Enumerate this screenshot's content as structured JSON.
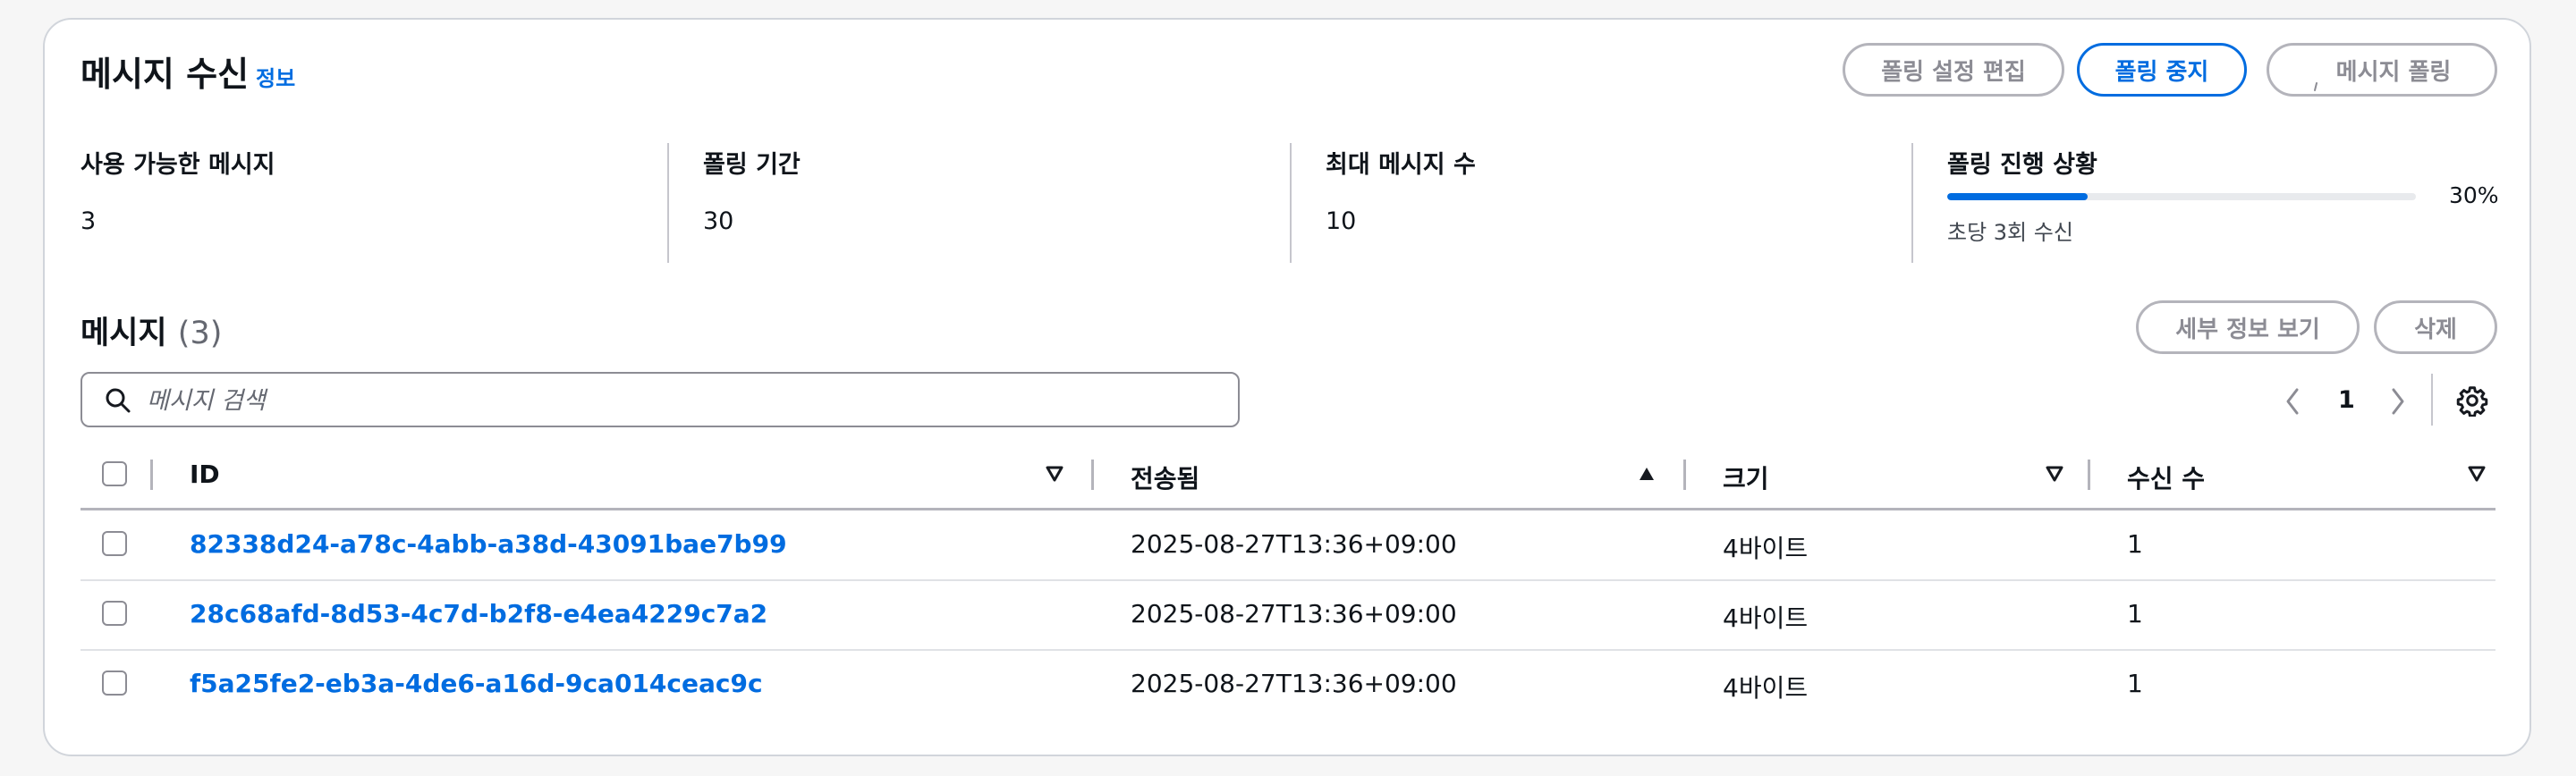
{
  "header": {
    "title": "메시지 수신",
    "info_link": "정보",
    "buttons": {
      "edit_polling_settings": "폴링 설정 편집",
      "stop_polling": "폴링 중지",
      "poll_messages": "메시지 폴링"
    }
  },
  "stats": {
    "available_messages": {
      "label": "사용 가능한 메시지",
      "value": "3"
    },
    "polling_duration": {
      "label": "폴링 기간",
      "value": "30"
    },
    "max_messages": {
      "label": "최대 메시지 수",
      "value": "10"
    },
    "polling_progress": {
      "label": "폴링 진행 상황",
      "percent": 30,
      "percent_text": "30%",
      "rate_text": "초당 3회 수신"
    }
  },
  "messages": {
    "title": "메시지",
    "count_text": "(3)",
    "buttons": {
      "view_details": "세부 정보 보기",
      "delete": "삭제"
    },
    "search_placeholder": "메시지 검색",
    "pagination": {
      "current_page": "1"
    },
    "columns": {
      "id": "ID",
      "sent": "전송됨",
      "size": "크기",
      "receive_count": "수신 수"
    },
    "rows": [
      {
        "id": "82338d24-a78c-4abb-a38d-43091bae7b99",
        "sent": "2025-08-27T13:36+09:00",
        "size": "4바이트",
        "receive_count": "1"
      },
      {
        "id": "28c68afd-8d53-4c7d-b2f8-e4ea4229c7a2",
        "sent": "2025-08-27T13:36+09:00",
        "size": "4바이트",
        "receive_count": "1"
      },
      {
        "id": "f5a25fe2-eb3a-4de6-a16d-9ca014ceac9c",
        "sent": "2025-08-27T13:36+09:00",
        "size": "4바이트",
        "receive_count": "1"
      }
    ]
  },
  "colors": {
    "accent": "#006ce0",
    "text": "#0f141a",
    "disabled": "#8c8c94"
  },
  "icons": {
    "search": "search-icon",
    "prev": "chevron-left-icon",
    "next": "chevron-right-icon",
    "settings": "gear-icon",
    "sort_desc": "caret-down-outline-icon",
    "sort_asc": "caret-up-filled-icon"
  }
}
